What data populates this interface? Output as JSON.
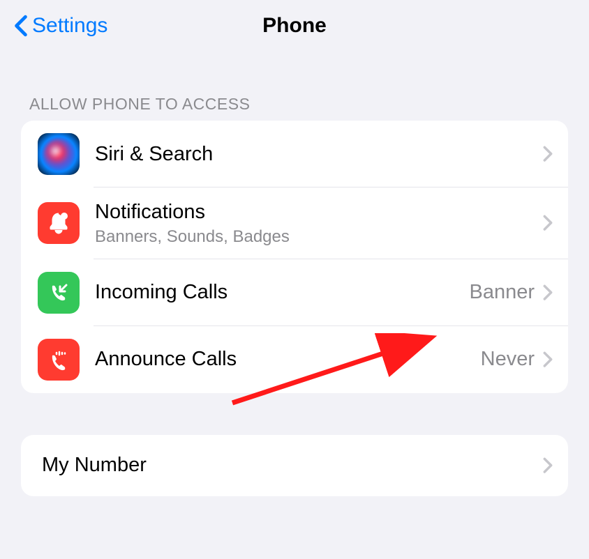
{
  "nav": {
    "back_label": "Settings",
    "title": "Phone"
  },
  "section1": {
    "header": "ALLOW PHONE TO ACCESS",
    "rows": {
      "siri": {
        "label": "Siri & Search"
      },
      "notifications": {
        "label": "Notifications",
        "sublabel": "Banners, Sounds, Badges"
      },
      "incoming": {
        "label": "Incoming Calls",
        "value": "Banner"
      },
      "announce": {
        "label": "Announce Calls",
        "value": "Never"
      }
    }
  },
  "section2": {
    "rows": {
      "mynumber": {
        "label": "My Number"
      }
    }
  }
}
